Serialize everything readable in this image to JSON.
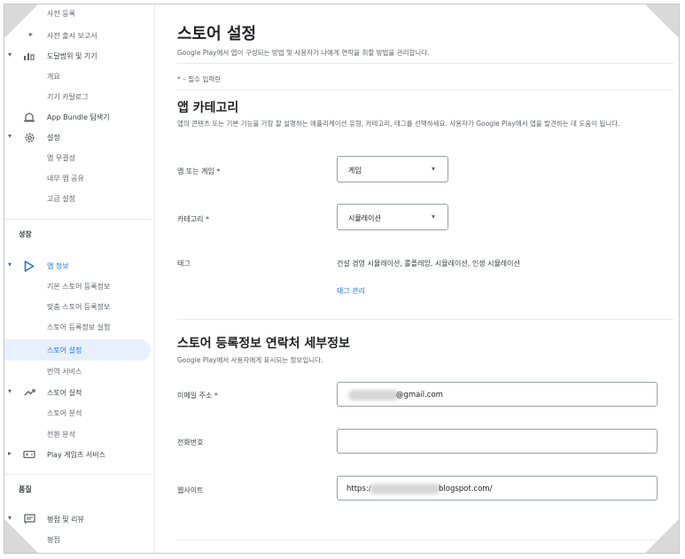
{
  "sidebar": {
    "items": [
      {
        "label": "사전 등록",
        "icon": "",
        "arrow": ""
      },
      {
        "label": "사전 출시 보고서",
        "icon": "",
        "arrow": "▸"
      },
      {
        "label": "도달범위 및 기기",
        "icon": "bar-chart-icon",
        "arrow": "▾"
      },
      {
        "label": "개요",
        "icon": "",
        "arrow": ""
      },
      {
        "label": "기기 카탈로그",
        "icon": "",
        "arrow": ""
      },
      {
        "label": "App Bundle 탐색기",
        "icon": "app-bundle-icon",
        "arrow": ""
      },
      {
        "label": "설정",
        "icon": "gear-icon",
        "arrow": "▾"
      },
      {
        "label": "앱 무결성",
        "icon": "",
        "arrow": ""
      },
      {
        "label": "내부 앱 공유",
        "icon": "",
        "arrow": ""
      },
      {
        "label": "고급 설정",
        "icon": "",
        "arrow": ""
      },
      {
        "label": "앱 정보",
        "icon": "play-icon",
        "arrow": "▾"
      },
      {
        "label": "기본 스토어 등록정보",
        "icon": "",
        "arrow": ""
      },
      {
        "label": "맞춤 스토어 등록정보",
        "icon": "",
        "arrow": ""
      },
      {
        "label": "스토어 등록정보 실험",
        "icon": "",
        "arrow": ""
      },
      {
        "label": "스토어 설정",
        "icon": "",
        "arrow": ""
      },
      {
        "label": "번역 서비스",
        "icon": "",
        "arrow": ""
      },
      {
        "label": "스토어 실적",
        "icon": "trending-icon",
        "arrow": "▾"
      },
      {
        "label": "스토어 분석",
        "icon": "",
        "arrow": ""
      },
      {
        "label": "전환 분석",
        "icon": "",
        "arrow": ""
      },
      {
        "label": "Play 게임즈 서비스",
        "icon": "gamepad-icon",
        "arrow": "▸"
      },
      {
        "label": "평점 및 리뷰",
        "icon": "review-icon",
        "arrow": "▾"
      },
      {
        "label": "평점",
        "icon": "",
        "arrow": ""
      }
    ],
    "section_growth": "성장",
    "section_quality": "품질"
  },
  "main": {
    "title": "스토어 설정",
    "subtitle": "Google Play에서 앱이 구성되는 방법 및 사용자가 나에게 연락을 취할 방법을 관리합니다.",
    "required_note": "* – 필수 입력란",
    "category_section": {
      "title": "앱 카테고리",
      "desc": "앱의 콘텐츠 또는 기본 기능을 가장 잘 설명하는 애플리케이션 유형, 카테고리, 태그를 선택하세요. 사용자가 Google Play에서 앱을 발견하는 데 도움이 됩니다.",
      "app_or_game_label": "앱 또는 게임 *",
      "app_or_game_value": "게임",
      "category_label": "카테고리 *",
      "category_value": "시뮬레이션",
      "tags_label": "태그",
      "tags_value": "건설 경영 시뮬레이션, 롤플레잉, 시뮬레이션, 인생 시뮬레이션",
      "tags_link": "태그 관리"
    },
    "contact_section": {
      "title": "스토어 등록정보 연락처 세부정보",
      "desc": "Google Play에서 사용자에게 표시되는 정보입니다.",
      "email_label": "이메일 주소 *",
      "email_value": "@gmail.com",
      "phone_label": "전화번호",
      "phone_value": "",
      "website_label": "웹사이트",
      "website_prefix": "https:/",
      "website_suffix": "blogspot.com/"
    }
  },
  "colors": {
    "accent": "#1a73e8",
    "active_bg": "#e8f0fe",
    "text": "#202124",
    "muted": "#5f6368"
  }
}
